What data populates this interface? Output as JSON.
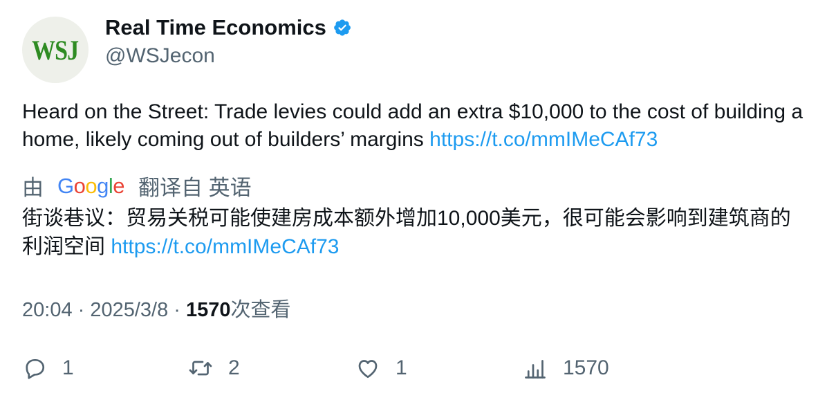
{
  "author": {
    "display_name": "Real Time Economics",
    "handle": "@WSJecon",
    "avatar_text": "WSJ",
    "verified": true
  },
  "tweet": {
    "text": "Heard on the Street: Trade levies could add an extra $10,000 to the cost of building a home, likely coming out of builders’ margins ",
    "link": "https://t.co/mmIMeCAf73"
  },
  "translation": {
    "prefix": "由",
    "provider": "Google",
    "suffix": "翻译自 英语",
    "text": "街谈巷议：贸易关税可能使建房成本额外增加10,000美元，很可能会影响到建筑商的利润空间 ",
    "link": "https://t.co/mmIMeCAf73"
  },
  "meta": {
    "time": "20:04",
    "separator": " · ",
    "date": "2025/3/8",
    "views_count": "1570",
    "views_label": "次查看"
  },
  "actions": {
    "replies": "1",
    "retweets": "2",
    "likes": "1",
    "views": "1570"
  },
  "colors": {
    "link": "#1d9bf0",
    "muted": "#536471",
    "verified": "#1d9bf0",
    "wsj_green": "#2e8b22"
  }
}
